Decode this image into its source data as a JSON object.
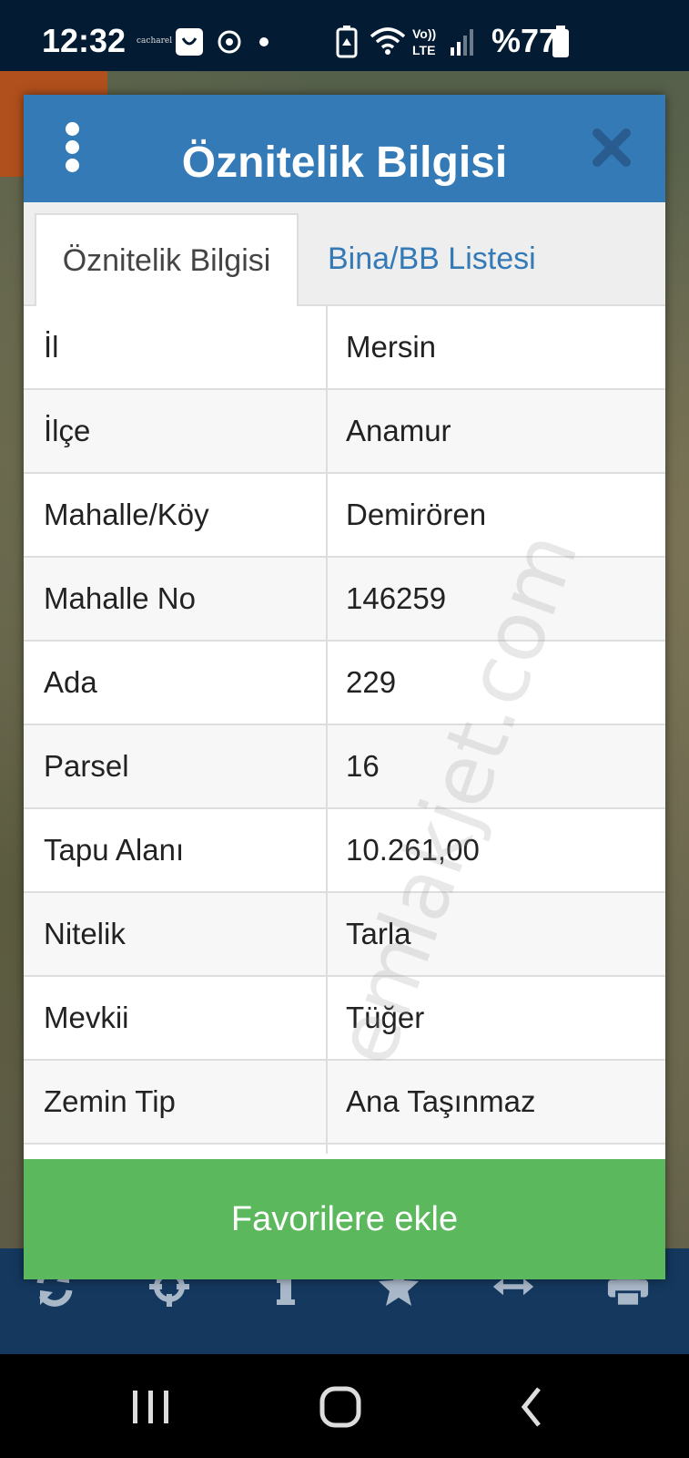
{
  "status_bar": {
    "time": "12:32",
    "mini_brand": "cacharel",
    "battery": "%77",
    "icons": [
      "shopping-bag-icon",
      "sync-icon",
      "dot-icon",
      "battery-saver-icon",
      "wifi-icon",
      "volte-icon",
      "signal-icon",
      "battery-icon"
    ]
  },
  "modal": {
    "title": "Öznitelik Bilgisi",
    "tabs": [
      {
        "label": "Öznitelik Bilgisi",
        "active": true
      },
      {
        "label": "Bina/BB Listesi",
        "active": false
      }
    ],
    "rows": [
      {
        "key": "İl",
        "value": "Mersin"
      },
      {
        "key": "İlçe",
        "value": "Anamur"
      },
      {
        "key": "Mahalle/Köy",
        "value": "Demirören"
      },
      {
        "key": "Mahalle No",
        "value": "146259"
      },
      {
        "key": "Ada",
        "value": "229"
      },
      {
        "key": "Parsel",
        "value": "16"
      },
      {
        "key": "Tapu Alanı",
        "value": "10.261,00"
      },
      {
        "key": "Nitelik",
        "value": "Tarla"
      },
      {
        "key": "Mevkii",
        "value": "Tüğer"
      },
      {
        "key": "Zemin Tip",
        "value": "Ana Taşınmaz"
      }
    ],
    "favorite_button": "Favorilere ekle",
    "watermark": "emlakjet.com"
  },
  "toolbar": {
    "icons": [
      "refresh-icon",
      "crosshair-icon",
      "info-icon",
      "star-icon",
      "arrows-horizontal-icon",
      "print-icon"
    ]
  },
  "colors": {
    "header": "#337ab7",
    "favorite": "#5cb85c",
    "status_bar": "#031c33",
    "toolbar": "#14385e"
  }
}
